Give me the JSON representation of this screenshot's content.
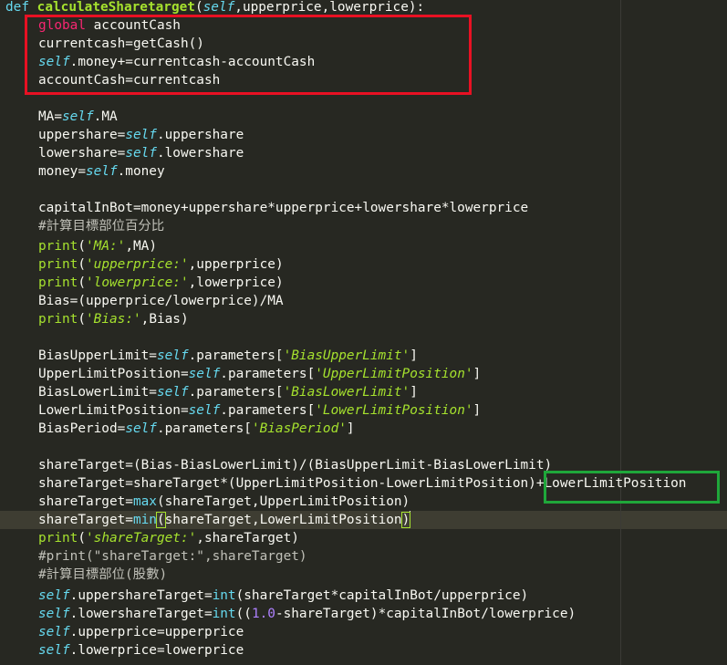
{
  "code": {
    "def_kw": "def",
    "func_name": "calculateSharetarget",
    "params_open": "(",
    "self_kw": "self",
    "params_rest": ",upperprice,lowerprice):",
    "l2_global": "global",
    "l2_rest": " accountCash",
    "l3": "currentcash=getCash()",
    "l4_self": "self",
    "l4_rest": ".money+=currentcash-accountCash",
    "l5": "accountCash=currentcash",
    "l7_a": "MA=",
    "l7_self": "self",
    "l7_b": ".MA",
    "l8_a": "uppershare=",
    "l8_self": "self",
    "l8_b": ".uppershare",
    "l9_a": "lowershare=",
    "l9_self": "self",
    "l9_b": ".lowershare",
    "l10_a": "money=",
    "l10_self": "self",
    "l10_b": ".money",
    "l12": "capitalInBot=money+uppershare*upperprice+lowershare*lowerprice",
    "l13_comment": "#計算目標部位百分比",
    "print_fn": "print",
    "l14_str": "'MA:'",
    "l14_rest": ",MA)",
    "l15_str": "'upperprice:'",
    "l15_rest": ",upperprice)",
    "l16_str": "'lowerprice:'",
    "l16_rest": ",lowerprice)",
    "l17": "Bias=(upperprice/lowerprice)/MA",
    "l18_str": "'Bias:'",
    "l18_rest": ",Bias)",
    "l20_a": "BiasUpperLimit=",
    "l20_self": "self",
    "l20_b": ".parameters[",
    "l20_str": "'BiasUpperLimit'",
    "l20_c": "]",
    "l21_a": "UpperLimitPosition=",
    "l21_self": "self",
    "l21_b": ".parameters[",
    "l21_str": "'UpperLimitPosition'",
    "l21_c": "]",
    "l22_a": "BiasLowerLimit=",
    "l22_self": "self",
    "l22_b": ".parameters[",
    "l22_str": "'BiasLowerLimit'",
    "l22_c": "]",
    "l23_a": "LowerLimitPosition=",
    "l23_self": "self",
    "l23_b": ".parameters[",
    "l23_str": "'LowerLimitPosition'",
    "l23_c": "]",
    "l24_a": "BiasPeriod=",
    "l24_self": "self",
    "l24_b": ".parameters[",
    "l24_str": "'BiasPeriod'",
    "l24_c": "]",
    "l26": "shareTarget=(Bias-BiasLowerLimit)/(BiasUpperLimit-BiasLowerLimit)",
    "l27": "shareTarget=shareTarget*(UpperLimitPosition-LowerLimitPosition)+LowerLimitPosition",
    "l28_a": "shareTarget=",
    "l28_max": "max",
    "l28_b": "(shareTarget,UpperLimitPosition)",
    "l29_a": "shareTarget=",
    "l29_min": "min",
    "l29_open": "(",
    "l29_b": "shareTarget,LowerLimitPosition",
    "l29_close": ")",
    "l30_str": "'shareTarget:'",
    "l30_rest": ",shareTarget)",
    "l31_comment": "#print(\"shareTarget:\",shareTarget)",
    "l32_comment": "#計算目標部位(股數)",
    "l33_self": "self",
    "l33_a": ".uppershareTarget=",
    "int_fn": "int",
    "l33_b": "(shareTarget*capitalInBot/upperprice)",
    "l34_self": "self",
    "l34_a": ".lowershareTarget=",
    "l34_b": "((",
    "l34_num": "1.0",
    "l34_c": "-shareTarget)*capitalInBot/lowerprice)",
    "l35_self": "self",
    "l35_a": ".upperprice=upperprice",
    "l36_self": "self",
    "l36_a": ".lowerprice=lowerprice"
  },
  "colors": {
    "background": "#272822",
    "keyword": "#66d9ef",
    "function": "#a6e22e",
    "annotation_red": "#e81123",
    "annotation_green": "#1fa73a"
  }
}
